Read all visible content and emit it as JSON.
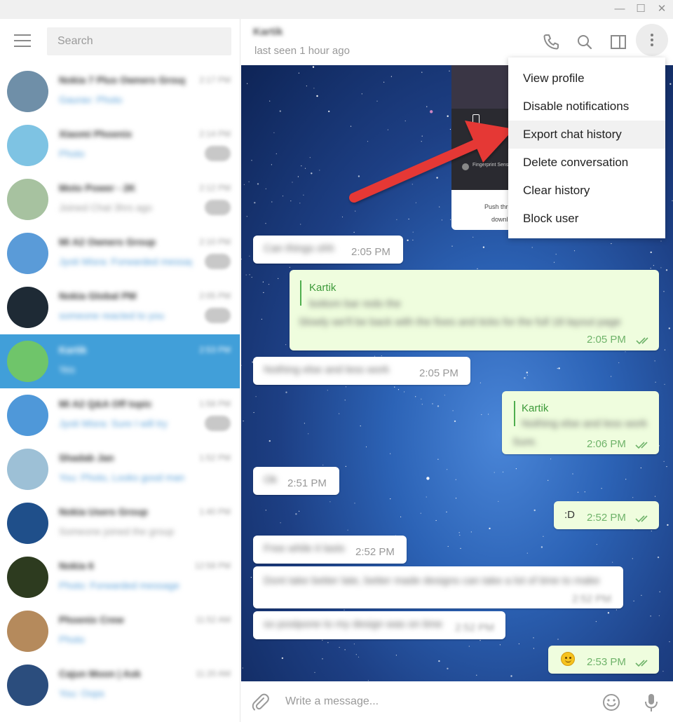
{
  "window": {
    "buttons": [
      {
        "name": "minimize",
        "glyph": "—"
      },
      {
        "name": "maximize",
        "glyph": "☐"
      },
      {
        "name": "close",
        "glyph": "✕"
      }
    ]
  },
  "sidebar": {
    "search_placeholder": "Search",
    "chats": [
      {
        "title": "Nokia 7 Plus Owners Group",
        "time": "2:17 PM",
        "preview": "Gaurav: Photo",
        "avatar_color": "#6f8fa8",
        "badge": false,
        "active": false
      },
      {
        "title": "Xiaomi Phoenix",
        "time": "2:14 PM",
        "preview": "Photo",
        "avatar_color": "#7ec3e3",
        "badge": true,
        "active": false
      },
      {
        "title": "Moto Power - 2K",
        "time": "2:12 PM",
        "preview": "Joined Chat 3hrs ago",
        "avatar_color": "#a7c2a0",
        "badge": true,
        "active": false
      },
      {
        "title": "Mi A2 Owners Group",
        "time": "2:10 PM",
        "preview": "Jyoti Misra: Forwarded message",
        "avatar_color": "#5a9bd8",
        "badge": true,
        "active": false
      },
      {
        "title": "Nokia Global PM",
        "time": "2:05 PM",
        "preview": "someone reacted to you",
        "avatar_color": "#1e2a35",
        "badge": true,
        "active": false
      },
      {
        "title": "Kartik",
        "time": "2:53 PM",
        "preview": "Yes",
        "avatar_color": "#6fc56a",
        "badge": false,
        "active": true
      },
      {
        "title": "Mi A2 Q&A Off topic",
        "time": "1:58 PM",
        "preview": "Jyoti Misra: Sure I will try",
        "avatar_color": "#4f98d9",
        "badge": true,
        "active": false
      },
      {
        "title": "Shadab Jan",
        "time": "1:52 PM",
        "preview": "You: Photo, Looks good man",
        "avatar_color": "#9dc0d6",
        "badge": false,
        "active": false
      },
      {
        "title": "Nokia Users Group",
        "time": "1:40 PM",
        "preview": "Someone joined the group",
        "avatar_color": "#1f4f8a",
        "badge": false,
        "active": false
      },
      {
        "title": "Nokia 6",
        "time": "12:58 PM",
        "preview": "Photo: Forwarded message",
        "avatar_color": "#2d3b1f",
        "badge": false,
        "active": false
      },
      {
        "title": "Phoenix Crew",
        "time": "11:52 AM",
        "preview": "Photo",
        "avatar_color": "#b58a5c",
        "badge": false,
        "active": false
      },
      {
        "title": "Cajun Moon | Ask",
        "time": "11:20 AM",
        "preview": "You: Oops",
        "avatar_color": "#2b4d7d",
        "badge": false,
        "active": false
      }
    ]
  },
  "header": {
    "contact_name": "Kartik",
    "last_seen": "last seen 1 hour ago",
    "icons": [
      "phone-icon",
      "search-icon",
      "sidebar-toggle-icon",
      "more-vertical-icon"
    ]
  },
  "menu": {
    "items": [
      "View profile",
      "Disable notifications",
      "Export chat history",
      "Delete conversation",
      "Clear history",
      "Block user"
    ],
    "hovered_index": 2
  },
  "preview_card": {
    "line1": "Push thro",
    "line2": "downl",
    "label": "Fingerprint Sensor"
  },
  "messages": [
    {
      "dir": "in",
      "text": "Can things ohh",
      "time": "2:05 PM"
    },
    {
      "dir": "out",
      "reply_name": "Kartik",
      "reply_text": "bottom bar redo the",
      "text": "Slowly we'll be back with the fixes and ticks for the full 18 layout page",
      "time": "2:05 PM"
    },
    {
      "dir": "in",
      "text": "Nothing else and less work",
      "time": "2:05 PM"
    },
    {
      "dir": "out",
      "reply_name": "Kartik",
      "reply_text": "Nothing else and less work",
      "text": "Sure.",
      "time": "2:06 PM"
    },
    {
      "dir": "in",
      "text": "Ok",
      "time": "2:51 PM"
    },
    {
      "dir": "out",
      "text": ":D",
      "time": "2:52 PM"
    },
    {
      "dir": "in",
      "text": "Free while it lasts",
      "time": "2:52 PM"
    },
    {
      "dir": "in",
      "text": "Dont take better late, better made designs can take a lot of time to make",
      "time": "2:52 PM"
    },
    {
      "dir": "in",
      "text": "so postpone to my design was on time",
      "time": "2:52 PM"
    },
    {
      "dir": "out",
      "emoji": "smile",
      "text": "",
      "time": "2:53 PM"
    }
  ],
  "composer": {
    "placeholder": "Write a message...",
    "icons": [
      "attach-icon",
      "emoji-icon",
      "microphone-icon"
    ]
  },
  "colors": {
    "accent": "#419fd9",
    "outgoing_bubble": "#effdde",
    "time_out": "#6fb36a",
    "annotation_arrow": "#e53935"
  }
}
